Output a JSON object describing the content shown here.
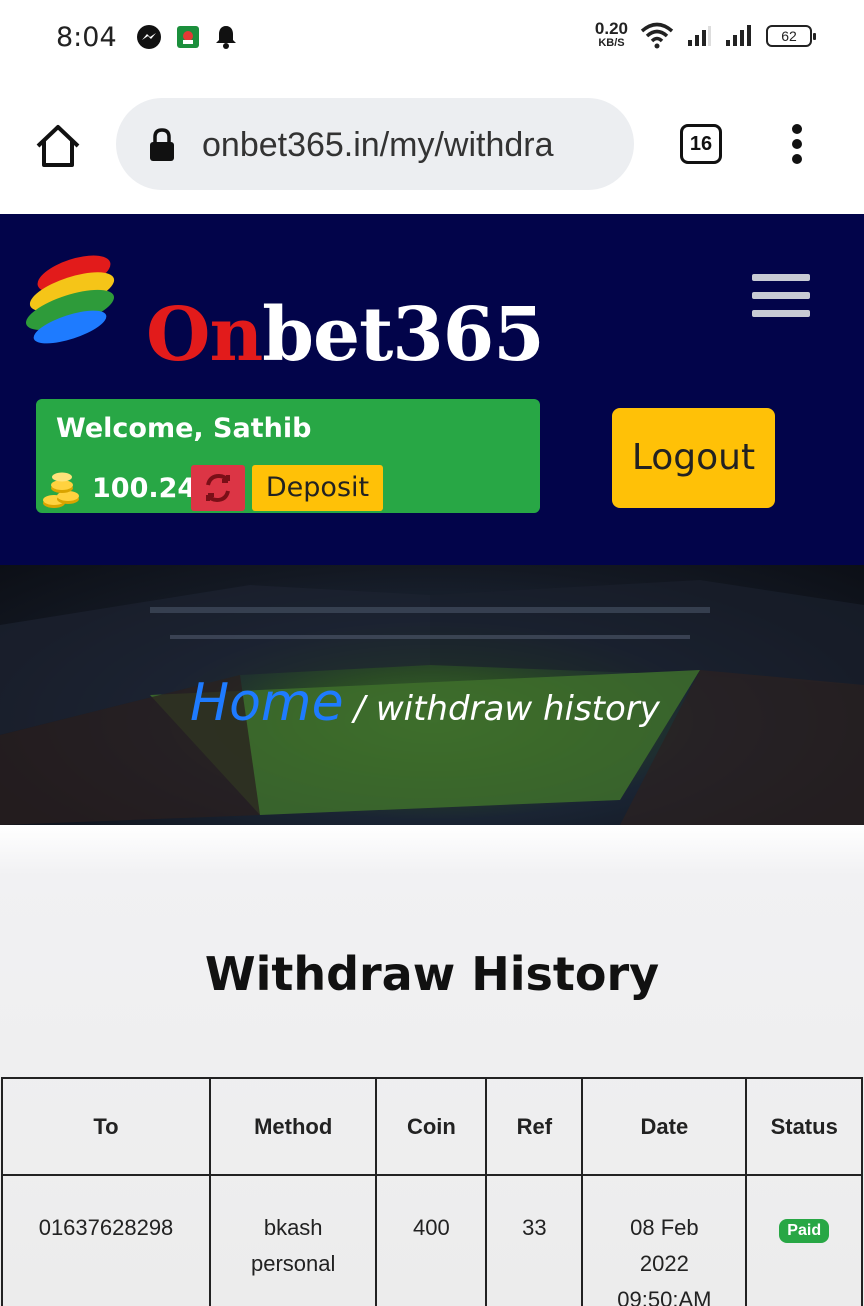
{
  "status_bar": {
    "time": "8:04",
    "speed_value": "0.20",
    "speed_unit": "KB/S",
    "battery": "62"
  },
  "browser": {
    "url": "onbet365.in/my/withdra",
    "tab_count": "16"
  },
  "header": {
    "logo_text_prefix": "On",
    "logo_text_suffix": "bet365",
    "welcome": "Welcome, Sathib",
    "balance": "100.24",
    "deposit_label": "Deposit",
    "logout_label": "Logout"
  },
  "breadcrumb": {
    "home": "Home",
    "current": "/ withdraw history"
  },
  "main": {
    "title": "Withdraw History"
  },
  "table": {
    "headers": [
      "To",
      "Method",
      "Coin",
      "Ref",
      "Date",
      "Status"
    ],
    "rows": [
      {
        "to": "01637628298",
        "method": "bkash personal",
        "coin": "400",
        "ref": "33",
        "date": "08 Feb 2022 09:50:AM",
        "status": "Paid"
      }
    ]
  },
  "colors": {
    "header_bg": "#02044a",
    "welcome_bg": "#28a745",
    "button_yellow": "#ffc107",
    "refresh_red": "#dc3545",
    "home_link": "#1e7bff"
  }
}
